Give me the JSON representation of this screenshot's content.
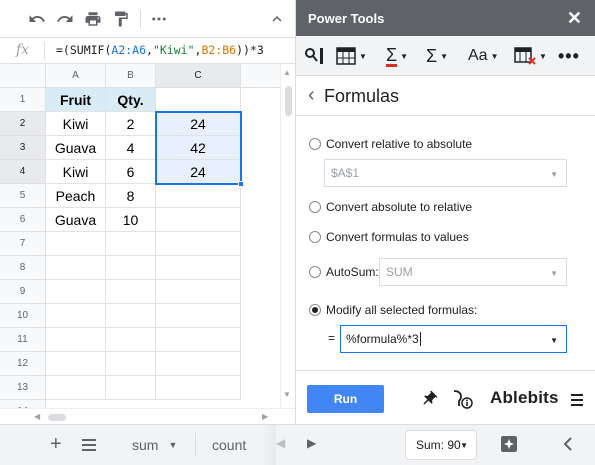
{
  "formula_bar": {
    "fx": "fx",
    "prefix": "=(SUMIF(",
    "range_a": "A2:A6",
    "comma1": ",",
    "criterion": "\"Kiwi\"",
    "comma2": ",",
    "range_b": "B2:B6",
    "suffix": "))*3"
  },
  "columns": [
    "A",
    "B",
    "C"
  ],
  "rows": [
    "1",
    "2",
    "3",
    "4",
    "5",
    "6",
    "7",
    "8",
    "9",
    "10",
    "11",
    "12",
    "13",
    "14"
  ],
  "cells": {
    "headers": [
      "Fruit",
      "Qty."
    ],
    "data": [
      [
        "Kiwi",
        "2",
        "24"
      ],
      [
        "Guava",
        "4",
        "42"
      ],
      [
        "Kiwi",
        "6",
        "24"
      ],
      [
        "Peach",
        "8",
        ""
      ],
      [
        "Guava",
        "10",
        ""
      ]
    ]
  },
  "bottom_bar": {
    "sheet_tabs": [
      "sum",
      "count"
    ],
    "sum_indicator": "Sum: 90"
  },
  "panel": {
    "title": "Power Tools",
    "heading": "Formulas",
    "options": {
      "relative_to_absolute": "Convert relative to absolute",
      "relative_select": "$A$1",
      "absolute_to_relative": "Convert absolute to relative",
      "formulas_to_values": "Convert formulas to values",
      "autosum": "AutoSum:",
      "autosum_select": "SUM",
      "modify_formulas": "Modify all selected formulas:",
      "equals": "=",
      "formula_value": "%formula%*3"
    },
    "run_label": "Run",
    "brand": "Ablebits"
  }
}
